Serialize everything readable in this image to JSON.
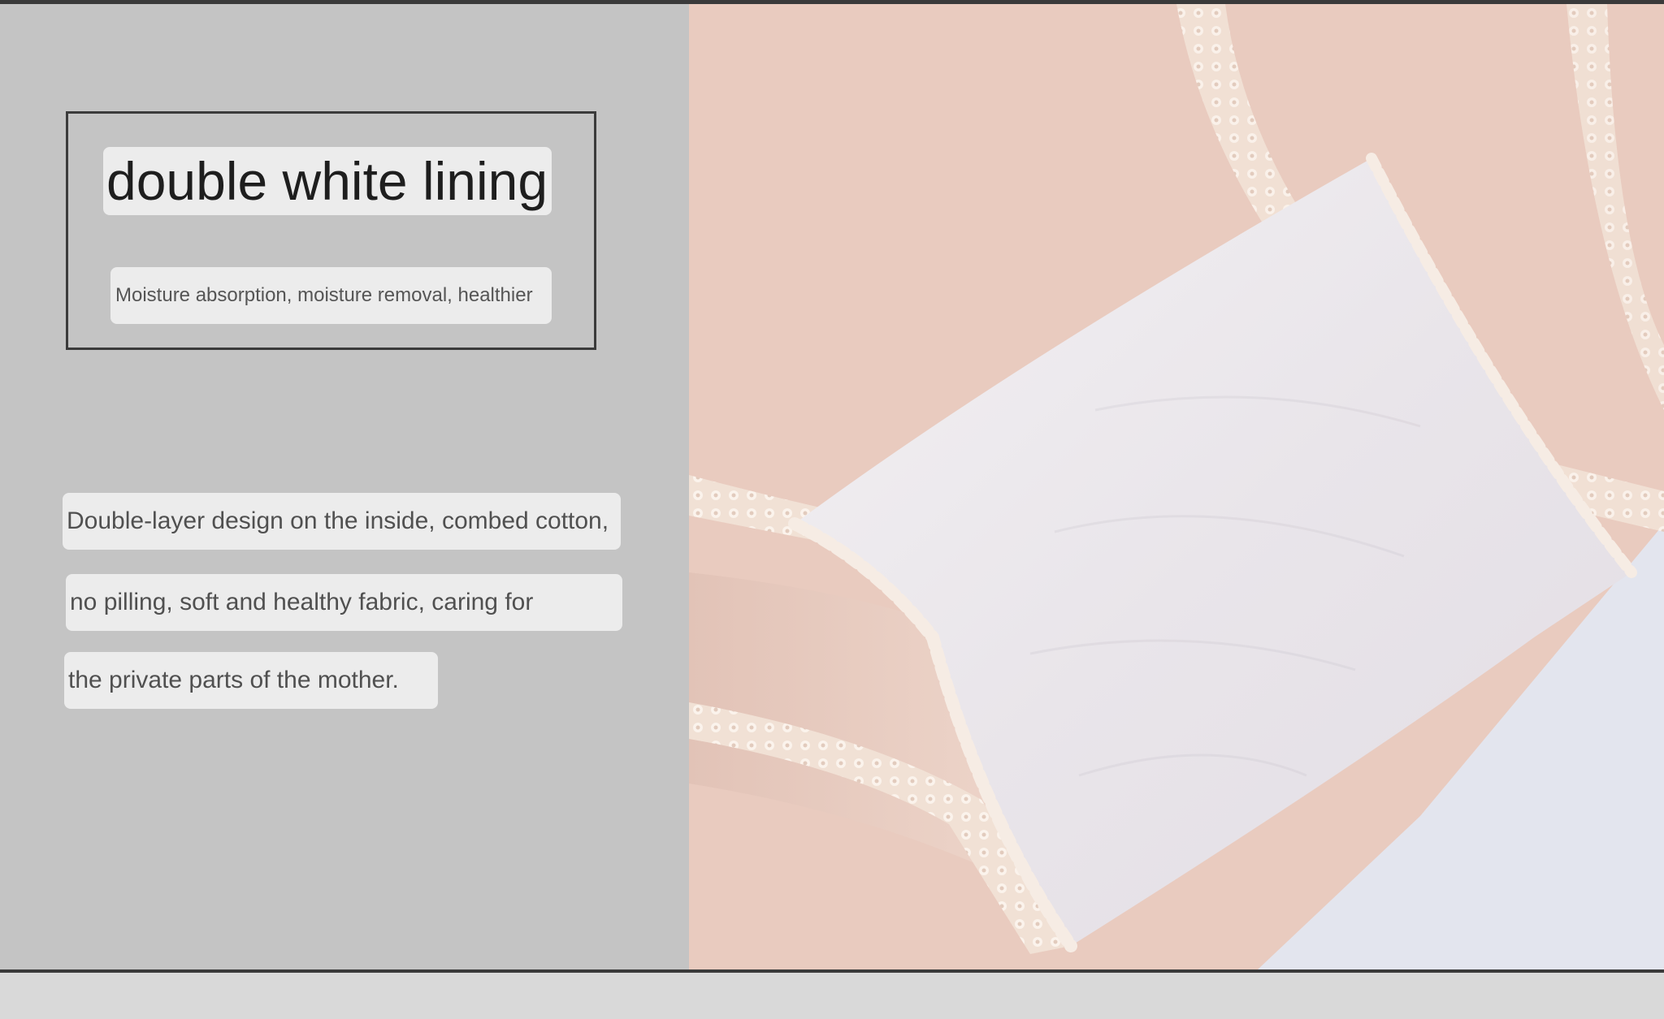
{
  "feature": {
    "title": "double white lining",
    "subtitle": "Moisture absorption, moisture removal, healthier",
    "body_lines": [
      "Double-layer design on the inside, combed cotton,",
      "no pilling, soft and healthy fabric, caring for",
      "the private parts of the mother."
    ]
  },
  "colors": {
    "left_panel": "#c4c4c4",
    "text_chip": "#ececec",
    "frame": "#3b3b3b",
    "fabric_pink": "#e8c9bd",
    "lining_white": "#ece9ec",
    "lace_trim": "#f2e2d6"
  },
  "photo": {
    "subject": "close-up of maternity underwear with double white cotton lining and scalloped lace trim"
  }
}
